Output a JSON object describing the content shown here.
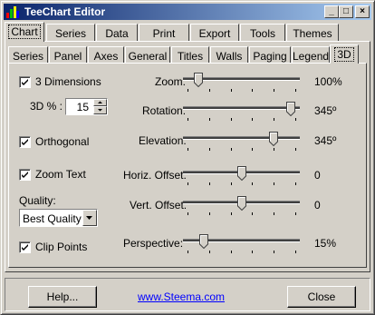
{
  "window": {
    "title": "TeeChart Editor"
  },
  "title_buttons": {
    "minimize": "_",
    "maximize": "□",
    "close": "×"
  },
  "main_tabs": [
    "Chart",
    "Series",
    "Data",
    "Print",
    "Export",
    "Tools",
    "Themes"
  ],
  "active_main_tab": "Chart",
  "sub_tabs": [
    "Series",
    "Panel",
    "Axes",
    "General",
    "Titles",
    "Walls",
    "Paging",
    "Legend",
    "3D"
  ],
  "active_sub_tab": "3D",
  "options": {
    "three_d": {
      "label": "3 Dimensions",
      "checked": true
    },
    "three_d_percent": {
      "label": "3D % :",
      "value": "15"
    },
    "orthogonal": {
      "label": "Orthogonal",
      "checked": true
    },
    "zoom_text": {
      "label": "Zoom Text",
      "checked": true
    },
    "quality": {
      "label": "Quality:",
      "value": "Best Quality"
    },
    "clip_points": {
      "label": "Clip Points",
      "checked": true
    }
  },
  "sliders": {
    "zoom": {
      "label": "Zoom:",
      "value_text": "100%",
      "fraction": 0.1
    },
    "rotation": {
      "label": "Rotation:",
      "value_text": "345º",
      "fraction": 0.96
    },
    "elevation": {
      "label": "Elevation:",
      "value_text": "345º",
      "fraction": 0.8
    },
    "horiz_offset": {
      "label": "Horiz. Offset:",
      "value_text": "0",
      "fraction": 0.5
    },
    "vert_offset": {
      "label": "Vert. Offset:",
      "value_text": "0",
      "fraction": 0.5
    },
    "perspective": {
      "label": "Perspective:",
      "value_text": "15%",
      "fraction": 0.15
    }
  },
  "footer": {
    "help_label": "Help...",
    "link_text": "www.Steema.com",
    "close_label": "Close"
  },
  "colors": {
    "titlebar_start": "#0a246a",
    "titlebar_end": "#a6caf0",
    "face": "#d4d0c8",
    "link": "#0000ff"
  }
}
